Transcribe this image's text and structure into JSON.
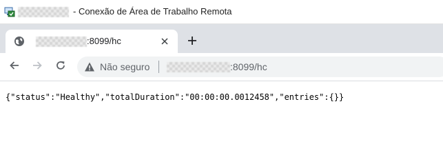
{
  "rdp_window": {
    "title": "- Conexão de Área de Trabalho Remota",
    "icon": "remote-desktop-icon"
  },
  "browser": {
    "tab": {
      "title": ":8099/hc",
      "favicon": "globe-icon",
      "close_icon": "close-icon"
    },
    "new_tab_icon": "plus-icon",
    "toolbar": {
      "back_icon": "arrow-left-icon",
      "forward_icon": "arrow-right-icon",
      "reload_icon": "reload-icon"
    },
    "address_bar": {
      "security_icon": "warning-triangle-icon",
      "security_text": "Não seguro",
      "url_visible_suffix": ":8099/hc"
    }
  },
  "page": {
    "body_text": "{\"status\":\"Healthy\",\"totalDuration\":\"00:00:00.0012458\",\"entries\":{}}"
  },
  "colors": {
    "tabstrip": "#dee1e6",
    "omnibox": "#f1f3f4",
    "icon_gray": "#5f6368",
    "disabled_gray": "#bdc1c6"
  }
}
